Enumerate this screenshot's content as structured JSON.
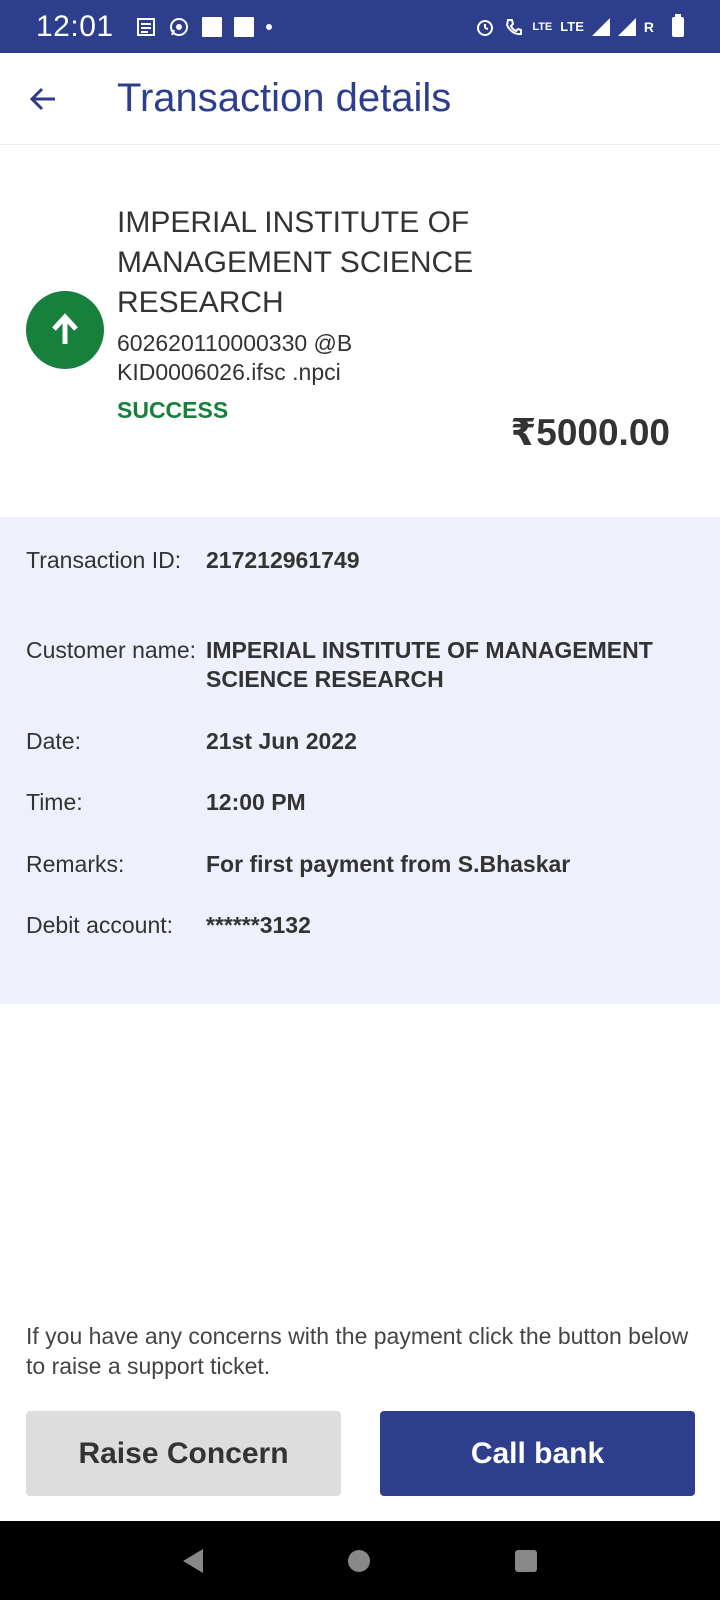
{
  "status_bar": {
    "time": "12:01",
    "network_label_1": "LTE",
    "network_label_2": "LTE",
    "roaming": "R",
    "icons": [
      "news-icon",
      "whatsapp-icon",
      "notification-square-icon",
      "notification-square-icon",
      "dot-icon",
      "alarm-icon",
      "volte-call-icon",
      "signal-icon",
      "signal-icon",
      "battery-icon"
    ]
  },
  "app_bar": {
    "title": "Transaction details",
    "back_icon": "arrow-left-icon"
  },
  "payee": {
    "name": "IMPERIAL INSTITUTE OF MANAGEMENT SCIENCE RESEARCH",
    "vpa": "602620110000330 @BKID0006026.ifsc .npci",
    "status": "SUCCESS",
    "amount": "₹5000.00",
    "icon": "arrow-up-icon"
  },
  "details": {
    "rows": [
      {
        "label": "Transaction ID:",
        "value": "217212961749"
      },
      {
        "label": "Customer name:",
        "value": "IMPERIAL INSTITUTE OF MANAGEMENT SCIENCE  RESEARCH"
      },
      {
        "label": "Date:",
        "value": "21st Jun 2022"
      },
      {
        "label": "Time:",
        "value": "12:00 PM"
      },
      {
        "label": "Remarks:",
        "value": "For first payment from S.Bhaskar"
      },
      {
        "label": "Debit account:",
        "value": "******3132"
      }
    ]
  },
  "footer": {
    "help_text": "If you have any concerns with the payment click the button below to raise a support ticket.",
    "raise_concern_label": "Raise Concern",
    "call_bank_label": "Call bank"
  },
  "colors": {
    "primary": "#2d3f8c",
    "success": "#17803d",
    "details_bg": "#eef0fb",
    "secondary_button": "#dddddd"
  }
}
